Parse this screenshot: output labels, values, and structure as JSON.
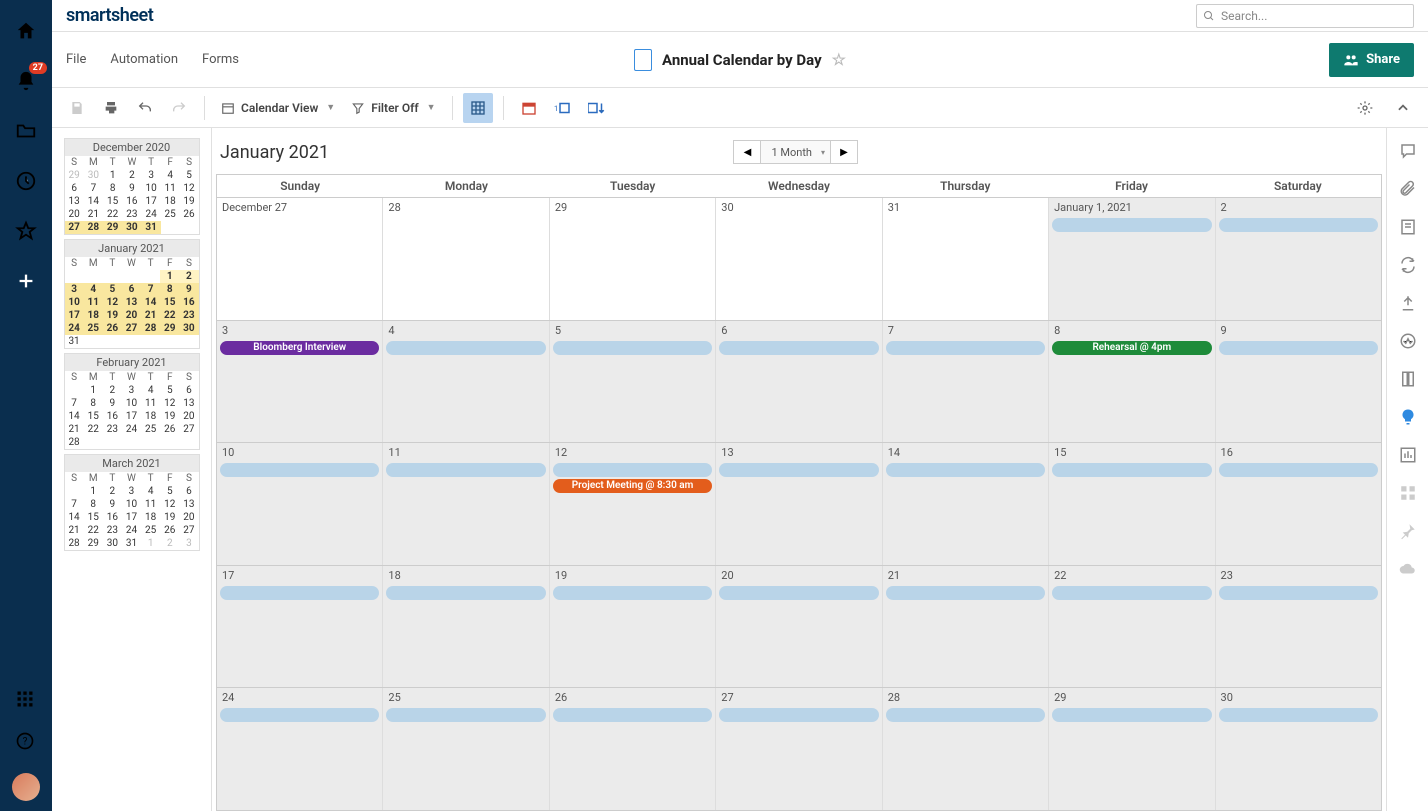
{
  "brand": "smartsheet",
  "search": {
    "placeholder": "Search..."
  },
  "nav": {
    "badge": "27"
  },
  "menu": {
    "file": "File",
    "automation": "Automation",
    "forms": "Forms"
  },
  "doc": {
    "title": "Annual Calendar by Day"
  },
  "share": {
    "label": "Share"
  },
  "toolbar": {
    "view": "Calendar View",
    "filter": "Filter Off"
  },
  "calendar": {
    "title": "January 2021",
    "range": "1 Month",
    "dow": [
      "Sunday",
      "Monday",
      "Tuesday",
      "Wednesday",
      "Thursday",
      "Friday",
      "Saturday"
    ],
    "weeks": [
      [
        {
          "label": "December 27",
          "prev": true
        },
        {
          "label": "28",
          "prev": true
        },
        {
          "label": "29",
          "prev": true
        },
        {
          "label": "30",
          "prev": true
        },
        {
          "label": "31",
          "prev": true
        },
        {
          "label": "January 1, 2021",
          "bars": [
            {
              "type": "blank"
            }
          ]
        },
        {
          "label": "2",
          "bars": [
            {
              "type": "blank"
            }
          ]
        }
      ],
      [
        {
          "label": "3",
          "bars": [
            {
              "type": "purple",
              "text": "Bloomberg Interview"
            }
          ]
        },
        {
          "label": "4",
          "bars": [
            {
              "type": "blank"
            }
          ]
        },
        {
          "label": "5",
          "bars": [
            {
              "type": "blank"
            }
          ]
        },
        {
          "label": "6",
          "bars": [
            {
              "type": "blank"
            }
          ]
        },
        {
          "label": "7",
          "bars": [
            {
              "type": "blank"
            }
          ]
        },
        {
          "label": "8",
          "bars": [
            {
              "type": "green",
              "text": "Rehearsal @ 4pm"
            }
          ]
        },
        {
          "label": "9",
          "bars": [
            {
              "type": "blank"
            }
          ]
        }
      ],
      [
        {
          "label": "10",
          "bars": [
            {
              "type": "blank"
            }
          ]
        },
        {
          "label": "11",
          "bars": [
            {
              "type": "blank"
            }
          ]
        },
        {
          "label": "12",
          "bars": [
            {
              "type": "blank"
            },
            {
              "type": "orange",
              "text": "Project Meeting @ 8:30 am"
            }
          ]
        },
        {
          "label": "13",
          "bars": [
            {
              "type": "blank"
            }
          ]
        },
        {
          "label": "14",
          "bars": [
            {
              "type": "blank"
            }
          ]
        },
        {
          "label": "15",
          "bars": [
            {
              "type": "blank"
            }
          ]
        },
        {
          "label": "16",
          "bars": [
            {
              "type": "blank"
            }
          ]
        }
      ],
      [
        {
          "label": "17",
          "bars": [
            {
              "type": "blank"
            }
          ]
        },
        {
          "label": "18",
          "bars": [
            {
              "type": "blank"
            }
          ]
        },
        {
          "label": "19",
          "bars": [
            {
              "type": "blank"
            }
          ]
        },
        {
          "label": "20",
          "bars": [
            {
              "type": "blank"
            }
          ]
        },
        {
          "label": "21",
          "bars": [
            {
              "type": "blank"
            }
          ]
        },
        {
          "label": "22",
          "bars": [
            {
              "type": "blank"
            }
          ]
        },
        {
          "label": "23",
          "bars": [
            {
              "type": "blank"
            }
          ]
        }
      ],
      [
        {
          "label": "24",
          "bars": [
            {
              "type": "blank"
            }
          ]
        },
        {
          "label": "25",
          "bars": [
            {
              "type": "blank"
            }
          ]
        },
        {
          "label": "26",
          "bars": [
            {
              "type": "blank"
            }
          ]
        },
        {
          "label": "27",
          "bars": [
            {
              "type": "blank"
            }
          ]
        },
        {
          "label": "28",
          "bars": [
            {
              "type": "blank"
            }
          ]
        },
        {
          "label": "29",
          "bars": [
            {
              "type": "blank"
            }
          ]
        },
        {
          "label": "30",
          "bars": [
            {
              "type": "blank"
            }
          ]
        }
      ]
    ]
  },
  "mini": [
    {
      "title": "December 2020",
      "dow": [
        "S",
        "M",
        "T",
        "W",
        "T",
        "F",
        "S"
      ],
      "rows": [
        [
          {
            "n": "29",
            "dim": true
          },
          {
            "n": "30",
            "dim": true
          },
          {
            "n": "1"
          },
          {
            "n": "2"
          },
          {
            "n": "3"
          },
          {
            "n": "4"
          },
          {
            "n": "5"
          }
        ],
        [
          {
            "n": "6"
          },
          {
            "n": "7"
          },
          {
            "n": "8"
          },
          {
            "n": "9"
          },
          {
            "n": "10"
          },
          {
            "n": "11"
          },
          {
            "n": "12"
          }
        ],
        [
          {
            "n": "13"
          },
          {
            "n": "14"
          },
          {
            "n": "15"
          },
          {
            "n": "16"
          },
          {
            "n": "17"
          },
          {
            "n": "18"
          },
          {
            "n": "19"
          }
        ],
        [
          {
            "n": "20"
          },
          {
            "n": "21"
          },
          {
            "n": "22"
          },
          {
            "n": "23"
          },
          {
            "n": "24"
          },
          {
            "n": "25"
          },
          {
            "n": "26"
          }
        ],
        [
          {
            "n": "27",
            "hl": true
          },
          {
            "n": "28",
            "hl": true
          },
          {
            "n": "29",
            "hl": true
          },
          {
            "n": "30",
            "hl": true
          },
          {
            "n": "31",
            "hl": true
          },
          {
            "n": ""
          },
          {
            "n": ""
          }
        ]
      ]
    },
    {
      "title": "January 2021",
      "dow": [
        "S",
        "M",
        "T",
        "W",
        "T",
        "F",
        "S"
      ],
      "rows": [
        [
          {
            "n": ""
          },
          {
            "n": ""
          },
          {
            "n": ""
          },
          {
            "n": ""
          },
          {
            "n": ""
          },
          {
            "n": "1",
            "hlw": true
          },
          {
            "n": "2",
            "hlw": true
          }
        ],
        [
          {
            "n": "3",
            "hl": true
          },
          {
            "n": "4",
            "hl": true
          },
          {
            "n": "5",
            "hl": true
          },
          {
            "n": "6",
            "hl": true
          },
          {
            "n": "7",
            "hl": true
          },
          {
            "n": "8",
            "hl": true
          },
          {
            "n": "9",
            "hl": true
          }
        ],
        [
          {
            "n": "10",
            "hl": true
          },
          {
            "n": "11",
            "hl": true
          },
          {
            "n": "12",
            "hl": true
          },
          {
            "n": "13",
            "hl": true
          },
          {
            "n": "14",
            "hl": true
          },
          {
            "n": "15",
            "hl": true
          },
          {
            "n": "16",
            "hl": true
          }
        ],
        [
          {
            "n": "17",
            "hl": true
          },
          {
            "n": "18",
            "hl": true
          },
          {
            "n": "19",
            "hl": true
          },
          {
            "n": "20",
            "hl": true
          },
          {
            "n": "21",
            "hl": true
          },
          {
            "n": "22",
            "hl": true
          },
          {
            "n": "23",
            "hl": true
          }
        ],
        [
          {
            "n": "24",
            "hl": true
          },
          {
            "n": "25",
            "hl": true
          },
          {
            "n": "26",
            "hl": true
          },
          {
            "n": "27",
            "hl": true
          },
          {
            "n": "28",
            "hl": true
          },
          {
            "n": "29",
            "hl": true
          },
          {
            "n": "30",
            "hl": true
          }
        ],
        [
          {
            "n": "31"
          },
          {
            "n": ""
          },
          {
            "n": ""
          },
          {
            "n": ""
          },
          {
            "n": ""
          },
          {
            "n": ""
          },
          {
            "n": ""
          }
        ]
      ]
    },
    {
      "title": "February 2021",
      "dow": [
        "S",
        "M",
        "T",
        "W",
        "T",
        "F",
        "S"
      ],
      "rows": [
        [
          {
            "n": ""
          },
          {
            "n": "1"
          },
          {
            "n": "2"
          },
          {
            "n": "3"
          },
          {
            "n": "4"
          },
          {
            "n": "5"
          },
          {
            "n": "6"
          }
        ],
        [
          {
            "n": "7"
          },
          {
            "n": "8"
          },
          {
            "n": "9"
          },
          {
            "n": "10"
          },
          {
            "n": "11"
          },
          {
            "n": "12"
          },
          {
            "n": "13"
          }
        ],
        [
          {
            "n": "14"
          },
          {
            "n": "15"
          },
          {
            "n": "16"
          },
          {
            "n": "17"
          },
          {
            "n": "18"
          },
          {
            "n": "19"
          },
          {
            "n": "20"
          }
        ],
        [
          {
            "n": "21"
          },
          {
            "n": "22"
          },
          {
            "n": "23"
          },
          {
            "n": "24"
          },
          {
            "n": "25"
          },
          {
            "n": "26"
          },
          {
            "n": "27"
          }
        ],
        [
          {
            "n": "28"
          },
          {
            "n": ""
          },
          {
            "n": ""
          },
          {
            "n": ""
          },
          {
            "n": ""
          },
          {
            "n": ""
          },
          {
            "n": ""
          }
        ]
      ]
    },
    {
      "title": "March 2021",
      "dow": [
        "S",
        "M",
        "T",
        "W",
        "T",
        "F",
        "S"
      ],
      "rows": [
        [
          {
            "n": ""
          },
          {
            "n": "1"
          },
          {
            "n": "2"
          },
          {
            "n": "3"
          },
          {
            "n": "4"
          },
          {
            "n": "5"
          },
          {
            "n": "6"
          }
        ],
        [
          {
            "n": "7"
          },
          {
            "n": "8"
          },
          {
            "n": "9"
          },
          {
            "n": "10"
          },
          {
            "n": "11"
          },
          {
            "n": "12"
          },
          {
            "n": "13"
          }
        ],
        [
          {
            "n": "14"
          },
          {
            "n": "15"
          },
          {
            "n": "16"
          },
          {
            "n": "17"
          },
          {
            "n": "18"
          },
          {
            "n": "19"
          },
          {
            "n": "20"
          }
        ],
        [
          {
            "n": "21"
          },
          {
            "n": "22"
          },
          {
            "n": "23"
          },
          {
            "n": "24"
          },
          {
            "n": "25"
          },
          {
            "n": "26"
          },
          {
            "n": "27"
          }
        ],
        [
          {
            "n": "28"
          },
          {
            "n": "29"
          },
          {
            "n": "30"
          },
          {
            "n": "31"
          },
          {
            "n": "1",
            "dim": true
          },
          {
            "n": "2",
            "dim": true
          },
          {
            "n": "3",
            "dim": true
          }
        ]
      ]
    }
  ]
}
